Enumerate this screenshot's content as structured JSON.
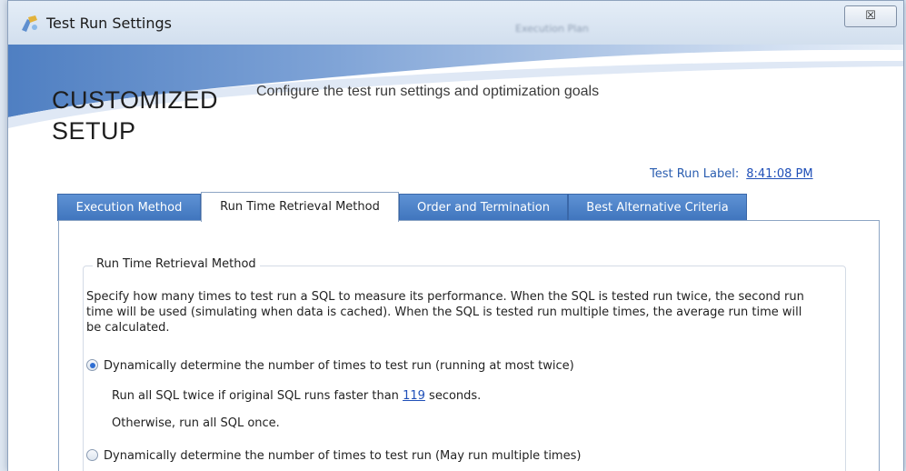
{
  "window": {
    "title": "Test Run Settings",
    "background_title": "Execution Plan",
    "close_label": "☒"
  },
  "header": {
    "title_line1": "CUSTOMIZED",
    "title_line2": "SETUP",
    "subtitle": "Configure the test run settings and optimization goals",
    "test_run_label": "Test Run Label:",
    "test_run_value": "8:41:08 PM"
  },
  "tabs": [
    {
      "label": "Execution Method",
      "active": false
    },
    {
      "label": "Run Time Retrieval Method",
      "active": true
    },
    {
      "label": "Order and Termination",
      "active": false
    },
    {
      "label": "Best Alternative Criteria",
      "active": false
    }
  ],
  "panel": {
    "group_title": "Run Time Retrieval Method",
    "description": "Specify how many times to test run a SQL to measure its performance. When the SQL is tested run twice, the second run time will be used (simulating when data is cached). When the SQL is tested run multiple times, the average run time will be calculated.",
    "option1": {
      "label": "Dynamically determine the number of times to test run (running at most twice)",
      "checked": true,
      "line1_prefix": "Run all SQL twice if original SQL runs faster than",
      "line1_value": "119",
      "line1_suffix": "seconds.",
      "line2": "Otherwise, run all SQL once."
    },
    "option2": {
      "label": "Dynamically determine the number of times to test run (May run multiple times)",
      "checked": false
    }
  },
  "colors": {
    "tab_blue": "#4a80c8",
    "link_blue": "#1f4fb8",
    "swoosh_blue": "#6f97cf"
  }
}
